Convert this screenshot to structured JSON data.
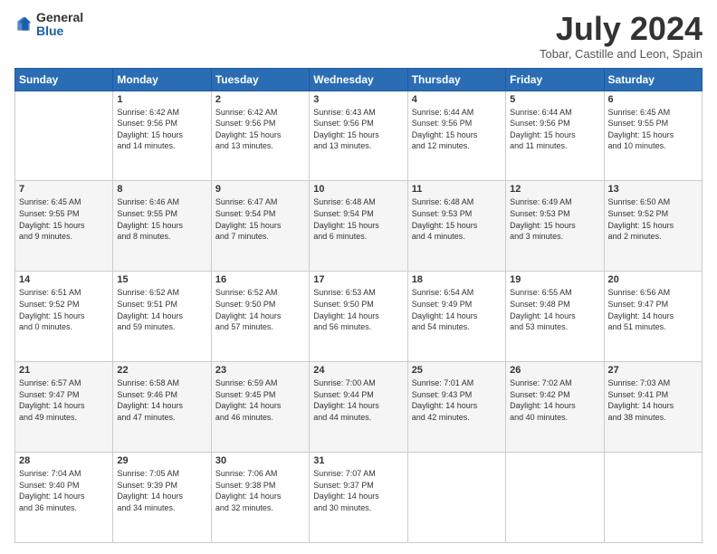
{
  "logo": {
    "general": "General",
    "blue": "Blue"
  },
  "title": "July 2024",
  "location": "Tobar, Castille and Leon, Spain",
  "days_header": [
    "Sunday",
    "Monday",
    "Tuesday",
    "Wednesday",
    "Thursday",
    "Friday",
    "Saturday"
  ],
  "weeks": [
    [
      {
        "day": "",
        "content": ""
      },
      {
        "day": "1",
        "content": "Sunrise: 6:42 AM\nSunset: 9:56 PM\nDaylight: 15 hours\nand 14 minutes."
      },
      {
        "day": "2",
        "content": "Sunrise: 6:42 AM\nSunset: 9:56 PM\nDaylight: 15 hours\nand 13 minutes."
      },
      {
        "day": "3",
        "content": "Sunrise: 6:43 AM\nSunset: 9:56 PM\nDaylight: 15 hours\nand 13 minutes."
      },
      {
        "day": "4",
        "content": "Sunrise: 6:44 AM\nSunset: 9:56 PM\nDaylight: 15 hours\nand 12 minutes."
      },
      {
        "day": "5",
        "content": "Sunrise: 6:44 AM\nSunset: 9:56 PM\nDaylight: 15 hours\nand 11 minutes."
      },
      {
        "day": "6",
        "content": "Sunrise: 6:45 AM\nSunset: 9:55 PM\nDaylight: 15 hours\nand 10 minutes."
      }
    ],
    [
      {
        "day": "7",
        "content": "Sunrise: 6:45 AM\nSunset: 9:55 PM\nDaylight: 15 hours\nand 9 minutes."
      },
      {
        "day": "8",
        "content": "Sunrise: 6:46 AM\nSunset: 9:55 PM\nDaylight: 15 hours\nand 8 minutes."
      },
      {
        "day": "9",
        "content": "Sunrise: 6:47 AM\nSunset: 9:54 PM\nDaylight: 15 hours\nand 7 minutes."
      },
      {
        "day": "10",
        "content": "Sunrise: 6:48 AM\nSunset: 9:54 PM\nDaylight: 15 hours\nand 6 minutes."
      },
      {
        "day": "11",
        "content": "Sunrise: 6:48 AM\nSunset: 9:53 PM\nDaylight: 15 hours\nand 4 minutes."
      },
      {
        "day": "12",
        "content": "Sunrise: 6:49 AM\nSunset: 9:53 PM\nDaylight: 15 hours\nand 3 minutes."
      },
      {
        "day": "13",
        "content": "Sunrise: 6:50 AM\nSunset: 9:52 PM\nDaylight: 15 hours\nand 2 minutes."
      }
    ],
    [
      {
        "day": "14",
        "content": "Sunrise: 6:51 AM\nSunset: 9:52 PM\nDaylight: 15 hours\nand 0 minutes."
      },
      {
        "day": "15",
        "content": "Sunrise: 6:52 AM\nSunset: 9:51 PM\nDaylight: 14 hours\nand 59 minutes."
      },
      {
        "day": "16",
        "content": "Sunrise: 6:52 AM\nSunset: 9:50 PM\nDaylight: 14 hours\nand 57 minutes."
      },
      {
        "day": "17",
        "content": "Sunrise: 6:53 AM\nSunset: 9:50 PM\nDaylight: 14 hours\nand 56 minutes."
      },
      {
        "day": "18",
        "content": "Sunrise: 6:54 AM\nSunset: 9:49 PM\nDaylight: 14 hours\nand 54 minutes."
      },
      {
        "day": "19",
        "content": "Sunrise: 6:55 AM\nSunset: 9:48 PM\nDaylight: 14 hours\nand 53 minutes."
      },
      {
        "day": "20",
        "content": "Sunrise: 6:56 AM\nSunset: 9:47 PM\nDaylight: 14 hours\nand 51 minutes."
      }
    ],
    [
      {
        "day": "21",
        "content": "Sunrise: 6:57 AM\nSunset: 9:47 PM\nDaylight: 14 hours\nand 49 minutes."
      },
      {
        "day": "22",
        "content": "Sunrise: 6:58 AM\nSunset: 9:46 PM\nDaylight: 14 hours\nand 47 minutes."
      },
      {
        "day": "23",
        "content": "Sunrise: 6:59 AM\nSunset: 9:45 PM\nDaylight: 14 hours\nand 46 minutes."
      },
      {
        "day": "24",
        "content": "Sunrise: 7:00 AM\nSunset: 9:44 PM\nDaylight: 14 hours\nand 44 minutes."
      },
      {
        "day": "25",
        "content": "Sunrise: 7:01 AM\nSunset: 9:43 PM\nDaylight: 14 hours\nand 42 minutes."
      },
      {
        "day": "26",
        "content": "Sunrise: 7:02 AM\nSunset: 9:42 PM\nDaylight: 14 hours\nand 40 minutes."
      },
      {
        "day": "27",
        "content": "Sunrise: 7:03 AM\nSunset: 9:41 PM\nDaylight: 14 hours\nand 38 minutes."
      }
    ],
    [
      {
        "day": "28",
        "content": "Sunrise: 7:04 AM\nSunset: 9:40 PM\nDaylight: 14 hours\nand 36 minutes."
      },
      {
        "day": "29",
        "content": "Sunrise: 7:05 AM\nSunset: 9:39 PM\nDaylight: 14 hours\nand 34 minutes."
      },
      {
        "day": "30",
        "content": "Sunrise: 7:06 AM\nSunset: 9:38 PM\nDaylight: 14 hours\nand 32 minutes."
      },
      {
        "day": "31",
        "content": "Sunrise: 7:07 AM\nSunset: 9:37 PM\nDaylight: 14 hours\nand 30 minutes."
      },
      {
        "day": "",
        "content": ""
      },
      {
        "day": "",
        "content": ""
      },
      {
        "day": "",
        "content": ""
      }
    ]
  ]
}
